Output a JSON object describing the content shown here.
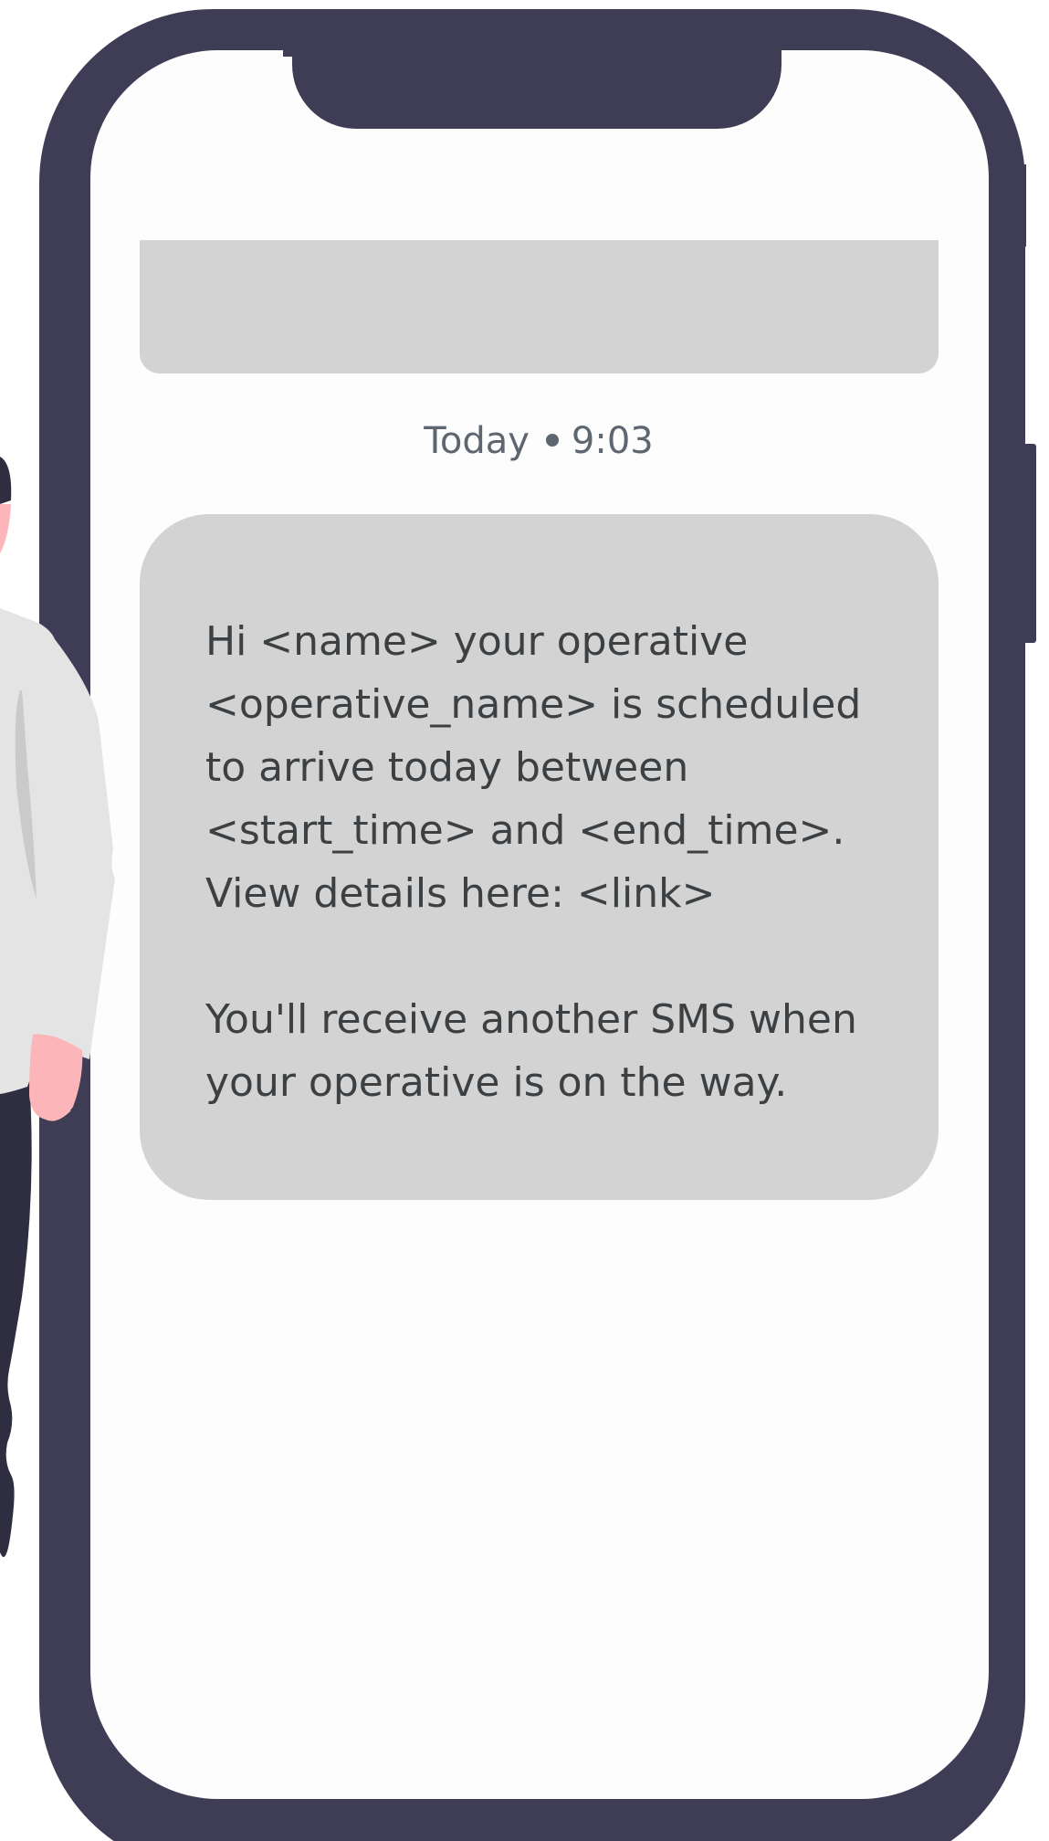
{
  "message_screen": {
    "timestamp": {
      "day": "Today",
      "time": "9:03"
    },
    "message": {
      "lines_paragraph_1": [
        "Hi <name> your operative",
        "<operative_name> is scheduled",
        "to arrive today between",
        "<start_time> and <end_time>.",
        "View details here: <link>"
      ],
      "lines_paragraph_2": [
        "You'll receive another SMS when",
        "your operative is on the way."
      ]
    }
  },
  "colors": {
    "phone_frame": "#3f3d56",
    "screen_background": "#fdfdfd",
    "message_bubble": "#d3d3d3",
    "message_text": "#3c4043",
    "timestamp_text": "#5e6670",
    "person_shirt": "#e4e4e4",
    "person_skin": "#fcb5b8",
    "person_trousers": "#2f2e41"
  }
}
